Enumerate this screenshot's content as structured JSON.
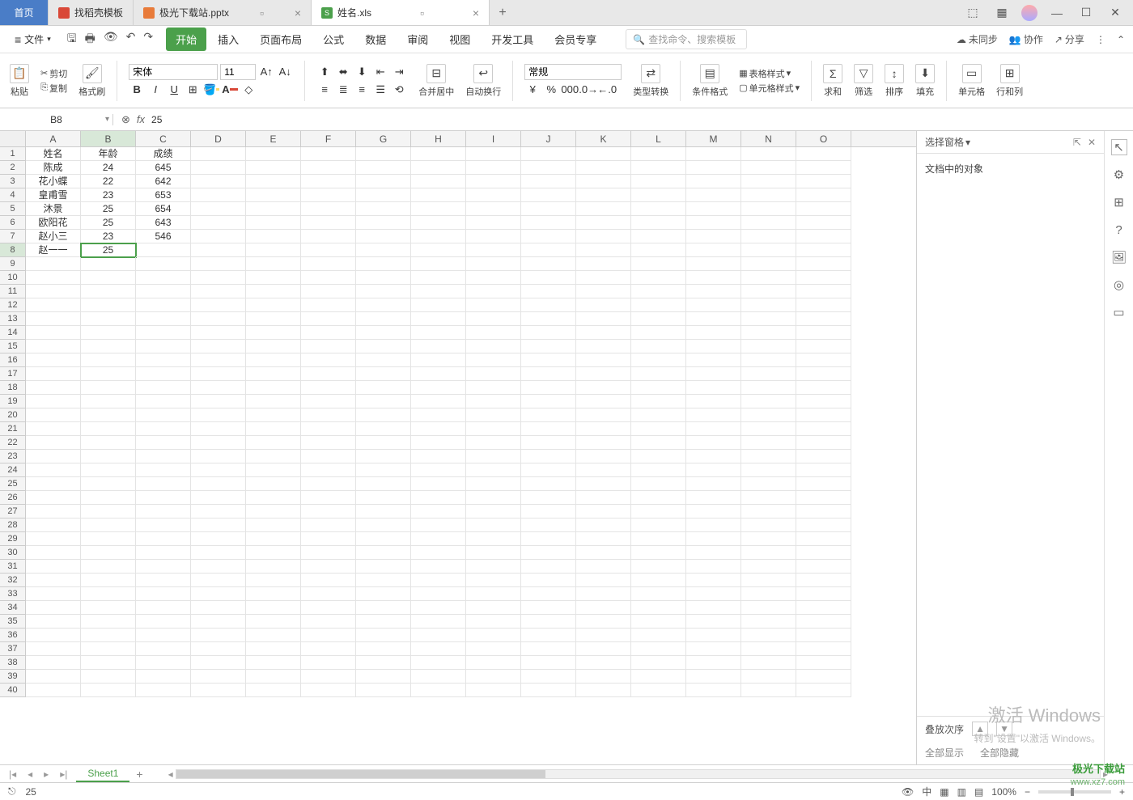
{
  "titlebar": {
    "home": "首页",
    "tabs": [
      {
        "label": "找稻壳模板",
        "icon": "red"
      },
      {
        "label": "极光下载站.pptx",
        "icon": "orange"
      },
      {
        "label": "姓名.xls",
        "icon": "green",
        "iconText": "S",
        "active": true
      }
    ],
    "addTab": "+"
  },
  "menubar": {
    "file": "文件",
    "tabs": [
      "开始",
      "插入",
      "页面布局",
      "公式",
      "数据",
      "审阅",
      "视图",
      "开发工具",
      "会员专享"
    ],
    "activeTab": "开始",
    "searchPlaceholder": "查找命令、搜索模板",
    "right": {
      "sync": "未同步",
      "collab": "协作",
      "share": "分享"
    }
  },
  "ribbon": {
    "paste": "粘贴",
    "cut": "剪切",
    "copy": "复制",
    "formatPainter": "格式刷",
    "fontName": "宋体",
    "fontSize": "11",
    "mergeCenter": "合并居中",
    "wrapText": "自动换行",
    "numberFormat": "常规",
    "typeConvert": "类型转换",
    "condFormat": "条件格式",
    "tableStyle": "表格样式",
    "cellStyle": "单元格样式",
    "sum": "求和",
    "filter": "筛选",
    "sort": "排序",
    "fill": "填充",
    "cellFmt": "单元格",
    "rowCol": "行和列"
  },
  "formula": {
    "nameBox": "B8",
    "value": "25"
  },
  "grid": {
    "columns": [
      "A",
      "B",
      "C",
      "D",
      "E",
      "F",
      "G",
      "H",
      "I",
      "J",
      "K",
      "L",
      "M",
      "N",
      "O"
    ],
    "selectedCol": "B",
    "selectedRow": 8,
    "headers": {
      "A": "姓名",
      "B": "年龄",
      "C": "成绩"
    },
    "data": [
      {
        "A": "陈成",
        "B": "24",
        "C": "645"
      },
      {
        "A": "花小蝶",
        "B": "22",
        "C": "642"
      },
      {
        "A": "皇甫雪",
        "B": "23",
        "C": "653"
      },
      {
        "A": "沐景",
        "B": "25",
        "C": "654"
      },
      {
        "A": "欧阳花",
        "B": "25",
        "C": "643"
      },
      {
        "A": "赵小三",
        "B": "23",
        "C": "546"
      },
      {
        "A": "赵一一",
        "B": "25",
        "C": ""
      }
    ],
    "totalRows": 40
  },
  "sidePanel": {
    "title": "选择窗格",
    "bodyText": "文档中的对象",
    "footer": {
      "label": "叠放次序",
      "showAll": "全部显示",
      "hideAll": "全部隐藏"
    }
  },
  "sheetTabs": {
    "active": "Sheet1"
  },
  "statusbar": {
    "value": "25",
    "zoom": "100%"
  },
  "watermark": {
    "line1": "激活 Windows",
    "line2": "转到\"设置\"以激活 Windows。",
    "logo1": "极光下载站",
    "logo2": "www.xz7.com"
  }
}
